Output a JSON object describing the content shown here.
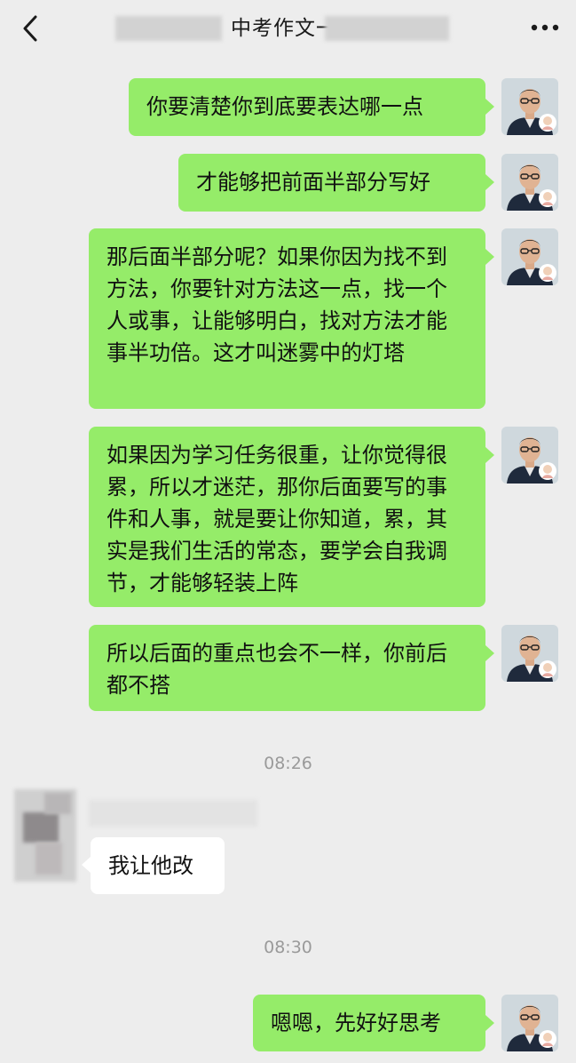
{
  "header": {
    "title_visible": "中考作文一",
    "back_icon": "chevron-left-icon",
    "more_icon": "more-dots-icon"
  },
  "messages": [
    {
      "side": "out",
      "text": "你要清楚你到底要表达哪一点"
    },
    {
      "side": "out",
      "text": "才能够把前面半部分写好"
    },
    {
      "side": "out",
      "text": "那后面半部分呢？如果你因为找不到方法，你要针对方法这一点，找一个人或事，让能够明白，找对方法才能事半功倍。这才叫迷雾中的灯塔"
    },
    {
      "side": "out",
      "text": "如果因为学习任务很重，让你觉得很累，所以才迷茫，那你后面要写的事件和人事，就是要让你知道，累，其实是我们生活的常态，要学会自我调节，才能够轻装上阵"
    },
    {
      "side": "out",
      "text": "所以后面的重点也会不一样，你前后都不搭"
    },
    {
      "side": "in",
      "text": "我让他改"
    },
    {
      "side": "out",
      "text": "嗯嗯，先好好思考"
    }
  ],
  "timestamps": [
    "08:26",
    "08:30"
  ],
  "colors": {
    "background": "#ededed",
    "outgoing_bubble": "#95ec69",
    "incoming_bubble": "#ffffff",
    "timestamp_text": "#9a9a9a"
  }
}
